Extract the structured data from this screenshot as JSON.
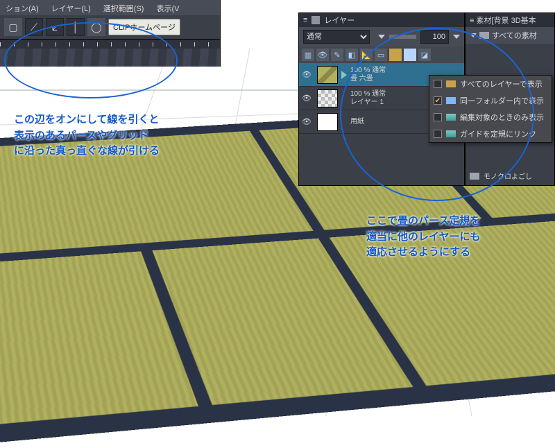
{
  "menu": {
    "action": "ション(A)",
    "layer": "レイヤー(L)",
    "select": "選択範囲(S)",
    "view": "表示(V"
  },
  "toolbar": {
    "clip_homepage": "CLIPホームページ"
  },
  "layers_panel": {
    "title": "レイヤー",
    "blend_mode": "通常",
    "opacity": "100",
    "rows": [
      {
        "pct": "100 %",
        "mode": "通常",
        "name": "畳 六畳"
      },
      {
        "pct": "100 %",
        "mode": "通常",
        "name": "レイヤー 1"
      },
      {
        "pct": "",
        "mode": "",
        "name": "用紙"
      }
    ]
  },
  "material_panel": {
    "title": "素材[背景 3D基本",
    "all": "すべての素材",
    "footer": "モノクロよごし"
  },
  "context_menu": {
    "item1": "すべてのレイヤーで表示",
    "item2": "同一フォルダー内で表示",
    "item3": "編集対象のときのみ表示",
    "item4": "ガイドを定規にリンク"
  },
  "annotation_left": "この辺をオンにして線を引くと\n表示のあるパースやグリッド\nに沿った真っ直ぐな線が引ける",
  "annotation_right": "ここで畳のパース定規を\n適当に他のレイヤーにも\n適応させるようにする"
}
